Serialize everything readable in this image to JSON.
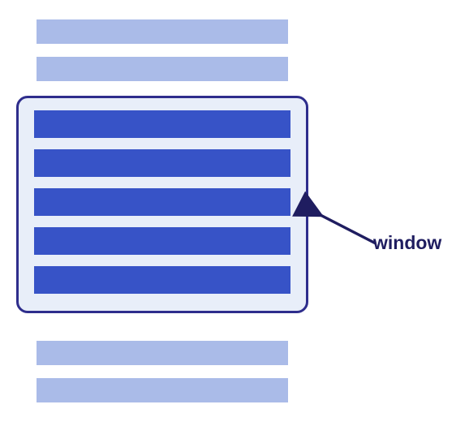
{
  "diagram": {
    "label_window": "window",
    "bar_count_outside_top": 2,
    "bar_count_inside_window": 5,
    "bar_count_outside_bottom": 2,
    "colors": {
      "outside_bar": "#aabbe8",
      "inside_bar": "#3753c7",
      "window_border": "#2e2d8c",
      "window_fill": "#e8eef9",
      "label_text": "#1f1d60"
    }
  }
}
